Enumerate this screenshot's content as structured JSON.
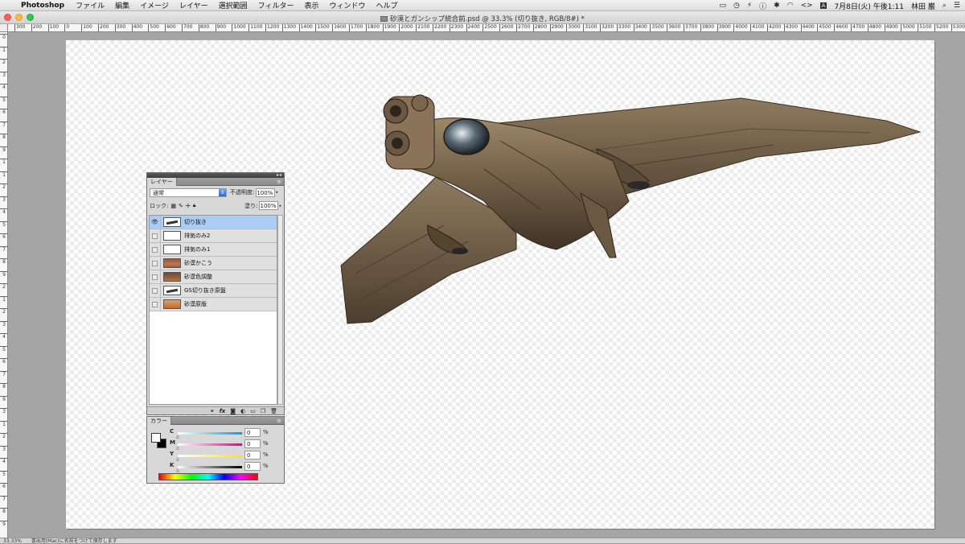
{
  "menubar": {
    "app_name": "Photoshop",
    "items": [
      "ファイル",
      "編集",
      "イメージ",
      "レイヤー",
      "選択範囲",
      "フィルター",
      "表示",
      "ウィンドウ",
      "ヘルプ"
    ],
    "datetime": "7月8日(火) 午後1:11",
    "user": "林田 巌",
    "input_mode": "A"
  },
  "window": {
    "title": "砂漠とガンシップ統合前.psd @ 33.3% (切り抜き, RGB/8#) *"
  },
  "rulers": {
    "horizontal": [
      "300",
      "200",
      "100",
      "0",
      "100",
      "200",
      "300",
      "400",
      "500",
      "600",
      "700",
      "800",
      "900",
      "1000",
      "1100",
      "1200",
      "1300",
      "1400",
      "1500",
      "1600",
      "1700",
      "1800",
      "1900",
      "2000",
      "2100",
      "2200",
      "2300",
      "2400",
      "2500",
      "2600",
      "2700",
      "2800",
      "2900",
      "3000",
      "3100",
      "3200",
      "3300",
      "3400",
      "3500",
      "3600",
      "3700",
      "3800",
      "3900",
      "4000",
      "4100",
      "4200",
      "4300",
      "4400",
      "4500",
      "4600",
      "4700",
      "4800",
      "4900",
      "5000",
      "5100",
      "5200",
      "5300"
    ],
    "vertical": [
      "0",
      "1",
      "2",
      "3",
      "4",
      "5",
      "6",
      "7",
      "8",
      "9",
      "1",
      "1",
      "2",
      "3",
      "4",
      "5",
      "6",
      "7",
      "8",
      "9",
      "2",
      "1",
      "2",
      "3",
      "4",
      "5",
      "6",
      "7",
      "8",
      "9",
      "3",
      "1",
      "2",
      "3",
      "4",
      "5",
      "6",
      "7",
      "8",
      "9"
    ]
  },
  "layers_panel": {
    "tab_label": "レイヤー",
    "blend_mode": "通常",
    "opacity_label": "不透明度:",
    "opacity_value": "100%",
    "lock_label": "ロック:",
    "fill_label": "塗り:",
    "fill_value": "100%",
    "layers": [
      {
        "name": "切り抜き",
        "visible": true,
        "selected": true,
        "thumb": "plane"
      },
      {
        "name": "排気のみ2",
        "visible": false,
        "selected": false,
        "thumb": "blank"
      },
      {
        "name": "排気のみ1",
        "visible": false,
        "selected": false,
        "thumb": "blank"
      },
      {
        "name": "砂漠かこう",
        "visible": false,
        "selected": false,
        "thumb": "desert"
      },
      {
        "name": "砂漠色調整",
        "visible": false,
        "selected": false,
        "thumb": "desert2"
      },
      {
        "name": "GS切り抜き原盤",
        "visible": false,
        "selected": false,
        "thumb": "plane"
      },
      {
        "name": "砂漠原版",
        "visible": false,
        "selected": false,
        "thumb": "desert3"
      }
    ],
    "footer_icons": [
      "link-icon",
      "fx-icon",
      "mask-icon",
      "adjustment-icon",
      "group-icon",
      "new-layer-icon",
      "trash-icon"
    ]
  },
  "color_panel": {
    "tab_label": "カラー",
    "channels": [
      {
        "letter": "C",
        "value": "0",
        "unit": "%"
      },
      {
        "letter": "M",
        "value": "0",
        "unit": "%"
      },
      {
        "letter": "Y",
        "value": "0",
        "unit": "%"
      },
      {
        "letter": "K",
        "value": "0",
        "unit": "%"
      }
    ],
    "fg_color": "#ffffff",
    "bg_color": "#000000"
  },
  "statusbar": {
    "zoom": "33.33%",
    "info": "書出用(Mac)に名前をつけて保存します"
  },
  "colors": {
    "selected_layer": "#a9cdf4",
    "aircraft_body": "#7a6650"
  }
}
